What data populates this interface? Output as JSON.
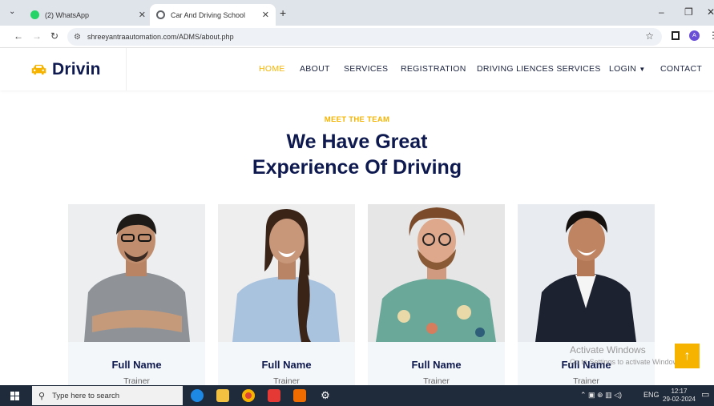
{
  "browser": {
    "tabs": [
      {
        "title": "(2) WhatsApp",
        "icon": "whatsapp-icon",
        "color": "#25d366"
      },
      {
        "title": "Car And Driving School",
        "icon": "globe-icon",
        "color": "#5f6368"
      }
    ],
    "url": "shreeyantraautomation.com/ADMS/about.php",
    "profile_initial": "A"
  },
  "site": {
    "brand": "Drivin",
    "brand_icon": "car-icon",
    "nav": [
      "HOME",
      "ABOUT",
      "SERVICES",
      "REGISTRATION",
      "DRIVING LIENCES SERVICES",
      "LOGIN",
      "CONTACT"
    ],
    "active_nav": "HOME",
    "accent_color": "#f6b400",
    "dark_color": "#0e1a4f"
  },
  "team": {
    "kicker": "MEET THE TEAM",
    "heading_line1": "We Have Great",
    "heading_line2": "Experience Of Driving",
    "members": [
      {
        "name": "Full Name",
        "role": "Trainer"
      },
      {
        "name": "Full Name",
        "role": "Trainer"
      },
      {
        "name": "Full Name",
        "role": "Trainer"
      },
      {
        "name": "Full Name",
        "role": "Trainer"
      }
    ]
  },
  "overlay": {
    "activate_title": "Activate Windows",
    "activate_sub": "Go to Settings to activate Windows."
  },
  "taskbar": {
    "search_placeholder": "Type here to search",
    "lang": "ENG",
    "time": "12:17",
    "date": "29-02-2024"
  }
}
